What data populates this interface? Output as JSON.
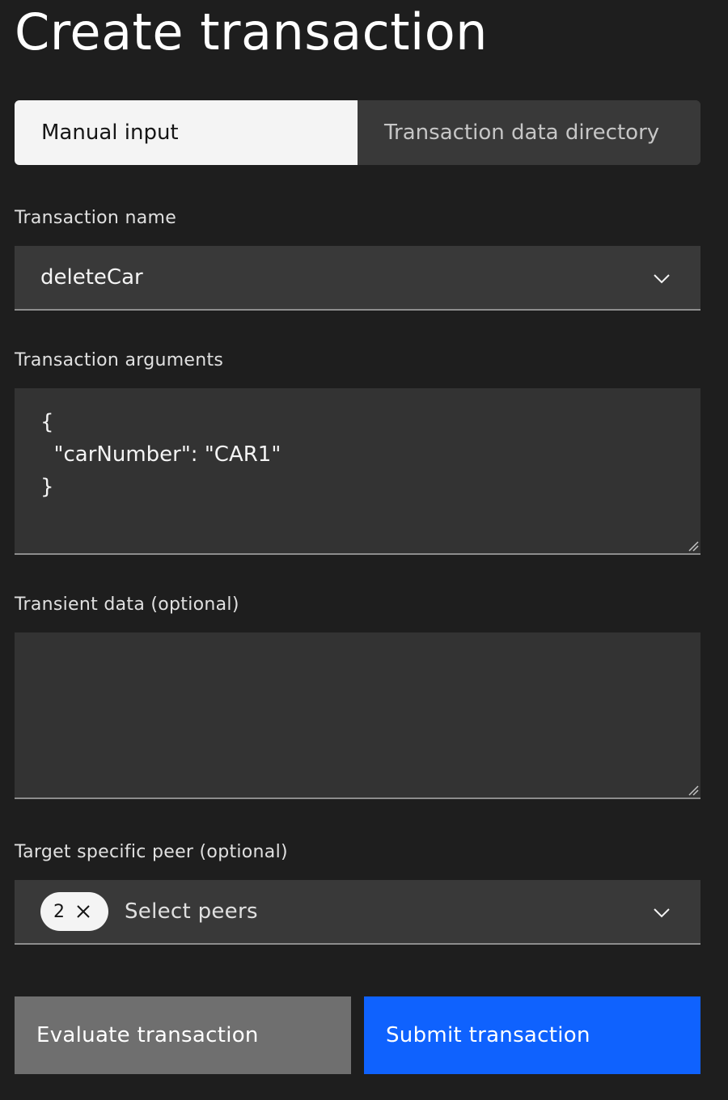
{
  "page": {
    "title": "Create transaction"
  },
  "tabs": [
    {
      "label": "Manual input",
      "active": true
    },
    {
      "label": "Transaction data directory",
      "active": false
    }
  ],
  "transaction_name": {
    "label": "Transaction name",
    "value": "deleteCar",
    "icon": "chevron-down-icon"
  },
  "transaction_arguments": {
    "label": "Transaction arguments",
    "value": "{\n  \"carNumber\": \"CAR1\"\n}"
  },
  "transient_data": {
    "label": "Transient data (optional)",
    "value": ""
  },
  "target_peer": {
    "label": "Target specific peer (optional)",
    "selected_count": "2",
    "placeholder": "Select peers",
    "icon": "chevron-down-icon"
  },
  "actions": {
    "evaluate_label": "Evaluate transaction",
    "submit_label": "Submit transaction"
  },
  "colors": {
    "background": "#1e1e1e",
    "primary": "#0f62fe",
    "secondary": "#6f6f6f",
    "field": "#393939"
  }
}
